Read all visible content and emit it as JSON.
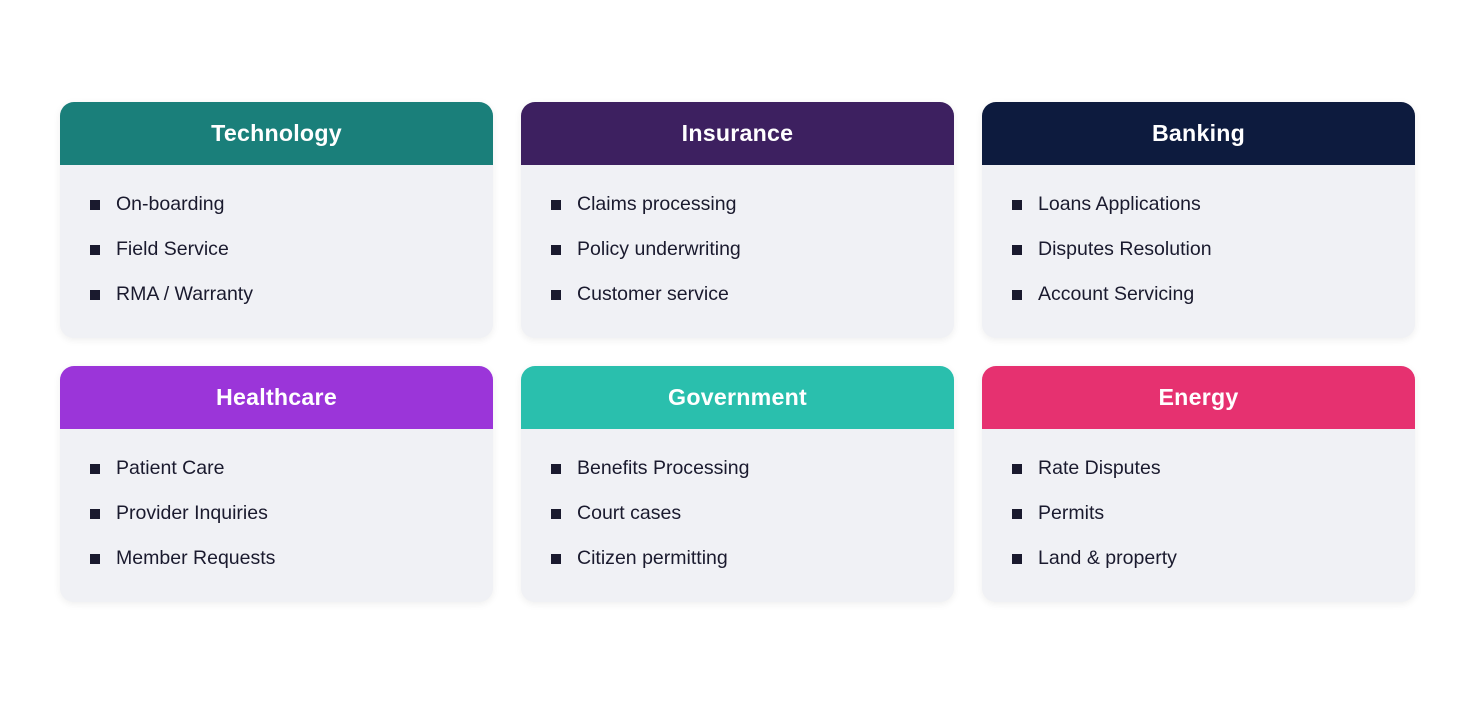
{
  "cards": [
    {
      "id": "technology",
      "header_class": "header-technology",
      "title": "Technology",
      "items": [
        "On-boarding",
        "Field Service",
        "RMA / Warranty"
      ]
    },
    {
      "id": "insurance",
      "header_class": "header-insurance",
      "title": "Insurance",
      "items": [
        "Claims processing",
        "Policy underwriting",
        "Customer service"
      ]
    },
    {
      "id": "banking",
      "header_class": "header-banking",
      "title": "Banking",
      "items": [
        "Loans Applications",
        "Disputes Resolution",
        "Account Servicing"
      ]
    },
    {
      "id": "healthcare",
      "header_class": "header-healthcare",
      "title": "Healthcare",
      "items": [
        "Patient Care",
        "Provider Inquiries",
        "Member Requests"
      ]
    },
    {
      "id": "government",
      "header_class": "header-government",
      "title": "Government",
      "items": [
        "Benefits Processing",
        "Court cases",
        "Citizen permitting"
      ]
    },
    {
      "id": "energy",
      "header_class": "header-energy",
      "title": "Energy",
      "items": [
        "Rate Disputes",
        "Permits",
        "Land & property"
      ]
    }
  ]
}
